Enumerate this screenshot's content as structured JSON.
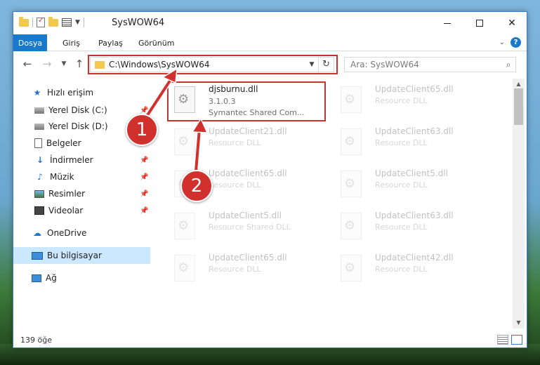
{
  "window": {
    "title": "SysWOW64",
    "minimize": "–",
    "maximize": "",
    "close": "✕"
  },
  "ribbon": {
    "tabs": [
      "Dosya",
      "Giriş",
      "Paylaş",
      "Görünüm"
    ]
  },
  "nav": {
    "address": "C:\\Windows\\SysWOW64",
    "search_placeholder": "Ara: SysWOW64"
  },
  "sidebar": {
    "items": [
      {
        "label": "Hızlı erişim",
        "icon": "star-icon"
      },
      {
        "label": "Yerel Disk (C:)",
        "icon": "disk-icon",
        "pinned": true
      },
      {
        "label": "Yerel Disk (D:)",
        "icon": "disk-icon",
        "pinned": true
      },
      {
        "label": "Belgeler",
        "icon": "documents-icon",
        "pinned": true
      },
      {
        "label": "İndirmeler",
        "icon": "download-icon",
        "pinned": true
      },
      {
        "label": "Müzik",
        "icon": "music-icon",
        "pinned": true
      },
      {
        "label": "Resimler",
        "icon": "pictures-icon",
        "pinned": true
      },
      {
        "label": "Videolar",
        "icon": "videos-icon",
        "pinned": true
      },
      {
        "label": "OneDrive",
        "icon": "cloud-icon"
      },
      {
        "label": "Bu bilgisayar",
        "icon": "computer-icon",
        "selected": true
      },
      {
        "label": "Ağ",
        "icon": "network-icon"
      }
    ]
  },
  "files": [
    {
      "name": "djsburnu.dll",
      "line2": "3.1.0.3",
      "line3": "Symantec Shared Com...",
      "highlighted": true
    },
    {
      "name": "UpdateClient65.dll",
      "line2": "Resource DLL"
    },
    {
      "name": "UpdateClient21.dll",
      "line2": "Resource DLL"
    },
    {
      "name": "UpdateClient63.dll",
      "line2": "Resource DLL"
    },
    {
      "name": "UpdateClient65.dll",
      "line2": "Resource DLL"
    },
    {
      "name": "UpdateClient5.dll",
      "line2": "Resource DLL"
    },
    {
      "name": "UpdateClient5.dll",
      "line2": "Resource Shared DLL"
    },
    {
      "name": "UpdateClient63.dll",
      "line2": "Resource DLL"
    },
    {
      "name": "UpdateClient65.dll",
      "line2": "Resource DLL"
    },
    {
      "name": "UpdateClient42.dll",
      "line2": "Resource DLL"
    }
  ],
  "status": {
    "count": "139 öğe"
  },
  "callouts": [
    "1",
    "2"
  ],
  "colors": {
    "accent": "#1979ca",
    "highlight": "#d0312d",
    "selection": "#cce8ff"
  }
}
